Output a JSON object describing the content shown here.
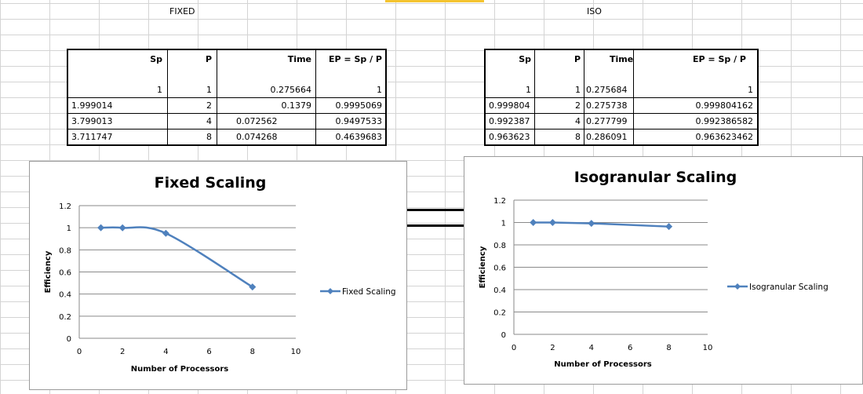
{
  "header": {
    "fixed_label": "FIXED",
    "iso_label": "ISO"
  },
  "tables": {
    "fixed": {
      "headers": [
        "Sp",
        "P",
        "Time",
        "EP = Sp / P"
      ],
      "rows": [
        [
          "1",
          "1",
          "0.275664",
          "1"
        ],
        [
          "1.999014",
          "2",
          "0.1379",
          "0.9995069"
        ],
        [
          "3.799013",
          "4",
          "0.072562",
          "0.9497533"
        ],
        [
          "3.711747",
          "8",
          "0.074268",
          "0.4639683"
        ]
      ]
    },
    "iso": {
      "headers": [
        "Sp",
        "P",
        "Time",
        "EP = Sp / P"
      ],
      "rows": [
        [
          "1",
          "1",
          "0.275684",
          "1"
        ],
        [
          "0.999804",
          "2",
          "0.275738",
          "0.999804162"
        ],
        [
          "0.992387",
          "4",
          "0.277799",
          "0.992386582"
        ],
        [
          "0.963623",
          "8",
          "0.286091",
          "0.963623462"
        ]
      ]
    }
  },
  "chart_data": [
    {
      "type": "line",
      "title": "Fixed Scaling",
      "xlabel": "Number of Processors",
      "ylabel": "Efficiency",
      "xlim": [
        0,
        10
      ],
      "ylim": [
        0,
        1.2
      ],
      "xticks": [
        "0",
        "2",
        "4",
        "6",
        "8",
        "10"
      ],
      "yticks": [
        "0",
        "0.2",
        "0.4",
        "0.6",
        "0.8",
        "1",
        "1.2"
      ],
      "grid": true,
      "legend": "right",
      "smooth": true,
      "color": "#4f81bd",
      "series": [
        {
          "name": "Fixed Scaling",
          "x": [
            1,
            2,
            4,
            8
          ],
          "values": [
            1,
            0.9995,
            0.9498,
            0.464
          ]
        }
      ]
    },
    {
      "type": "line",
      "title": "Isogranular Scaling",
      "xlabel": "Number of Processors",
      "ylabel": "Efficiency",
      "xlim": [
        0,
        10
      ],
      "ylim": [
        0,
        1.2
      ],
      "xticks": [
        "0",
        "2",
        "4",
        "6",
        "8",
        "10"
      ],
      "yticks": [
        "0",
        "0.2",
        "0.4",
        "0.6",
        "0.8",
        "1",
        "1.2"
      ],
      "grid": true,
      "legend": "right",
      "smooth": false,
      "color": "#4f81bd",
      "series": [
        {
          "name": "Isogranular Scaling",
          "x": [
            1,
            2,
            4,
            8
          ],
          "values": [
            1,
            0.9998,
            0.9924,
            0.9636
          ]
        }
      ]
    }
  ]
}
